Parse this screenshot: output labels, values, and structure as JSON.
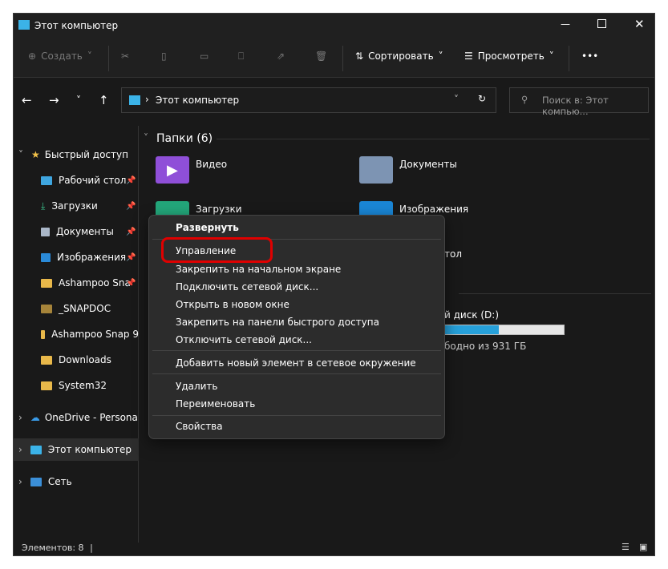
{
  "window": {
    "title": "Этот компьютер"
  },
  "toolbar": {
    "create": "Создать",
    "sort": "Сортировать",
    "view": "Просмотреть",
    "more": "•••"
  },
  "address": {
    "path": "Этот компьютер",
    "search_placeholder": "Поиск в: Этот компью..."
  },
  "nav": {
    "items": [
      {
        "label": "Быстрый доступ"
      },
      {
        "label": "Рабочий стол"
      },
      {
        "label": "Загрузки"
      },
      {
        "label": "Документы"
      },
      {
        "label": "Изображения"
      },
      {
        "label": "Ashampoo Sna"
      },
      {
        "label": "_SNAPDOC"
      },
      {
        "label": "Ashampoo Snap 9"
      },
      {
        "label": "Downloads"
      },
      {
        "label": "System32"
      },
      {
        "label": "OneDrive - Personal"
      },
      {
        "label": "Этот компьютер"
      },
      {
        "label": "Сеть"
      }
    ]
  },
  "main": {
    "folders_header": "Папки (6)",
    "folders": [
      {
        "label": "Видео",
        "color": "#8f4fd8"
      },
      {
        "label": "Документы",
        "color": "#7d94b3"
      },
      {
        "label": "Загрузки",
        "color": "#23a67a"
      },
      {
        "label": "Изображения",
        "color": "#1a86d6"
      },
      {
        "label": "тол"
      }
    ],
    "disk": {
      "label": "й диск (D:)",
      "free": "бодно из 931 ГБ",
      "used_fraction": 0.45
    }
  },
  "context_menu": {
    "items": [
      "Развернуть",
      "Управление",
      "Закрепить на начальном экране",
      "Подключить сетевой диск...",
      "Открыть в новом окне",
      "Закрепить на панели быстрого доступа",
      "Отключить сетевой диск...",
      "Добавить новый элемент в сетевое окружение",
      "Удалить",
      "Переименовать",
      "Свойства"
    ],
    "highlight_color": "#e00000"
  },
  "status": {
    "count": "Элементов: 8"
  }
}
